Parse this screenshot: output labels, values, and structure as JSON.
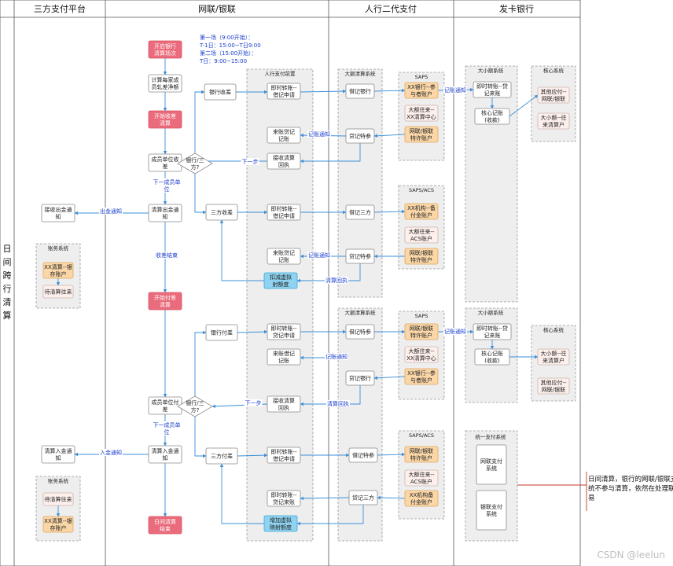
{
  "lanes": [
    "三方支付平台",
    "网联/银联",
    "人行二代支付",
    "发卡银行"
  ],
  "side_label": "日间跨行清算",
  "note": "日间清算，银行的网联/银联支付系统不参与清算，依然在处理联机交易",
  "watermark": "CSDN @leelun",
  "groups": {
    "renhang_front": "人行支付前置",
    "daer_1": "大额清算系统",
    "saps_1": "SAPS",
    "saps_acs_1": "SAPS/ACS",
    "daer_2": "大额清算系统",
    "saps_2": "SAPS",
    "saps_acs_2": "SAPS/ACS",
    "xiao_1": "大小额系统",
    "core_1": "核心系统",
    "xiao_2": "大小额系统",
    "core_2": "核心系统",
    "unified": "统一支付系统",
    "acct_1": "账务系统",
    "acct_2": "账务系统"
  },
  "session_info": {
    "l1": "第一场（9:00开始）：",
    "l2": "T-1日：15:00~T日9:00",
    "l3": "第二场（15:00开始）：",
    "l4": "T日：9:00~15:00"
  },
  "nodes": {
    "start_batch": [
      "开启银行",
      "清算场次"
    ],
    "calc_net": [
      "计算每家成",
      "员轧差净额"
    ],
    "start_recv": [
      "开始收差",
      "清算"
    ],
    "member_recv": [
      "成员单位收",
      "差"
    ],
    "diamond_1": [
      "银行/三",
      "方?"
    ],
    "bank_recv": [
      "银行收差"
    ],
    "clear_out_notice": [
      "清算出金通",
      "知"
    ],
    "third_recv": [
      "三方收差"
    ],
    "start_pay": [
      "开始付差",
      "清算"
    ],
    "bank_pay": [
      "银行付差"
    ],
    "member_pay": [
      "成员单位付",
      "差"
    ],
    "diamond_2": [
      "银行/三",
      "方?"
    ],
    "clear_in_notice": [
      "清算入金通",
      "知"
    ],
    "third_pay": [
      "三方付差"
    ],
    "day_end": [
      "日间清算",
      "结束"
    ],
    "recv_out_notice": [
      "接收出金通",
      "知"
    ],
    "recv_in_notice": [
      "清算入金通",
      "知"
    ],
    "acc_1a": [
      "XX清算--银",
      "存账户"
    ],
    "acc_1b": [
      "待清算往来"
    ],
    "acc_2a": [
      "待清算往来"
    ],
    "acc_2b": [
      "XX清算--银",
      "存账户"
    ],
    "f1": [
      "即时转账--",
      "借记申请"
    ],
    "f2": [
      "来账贷记",
      "记账"
    ],
    "f3": [
      "接收清算",
      "回执"
    ],
    "f4": [
      "即时转账--",
      "借记申请"
    ],
    "f5": [
      "来账贷记",
      "记账"
    ],
    "f6": [
      "扣减虚拟",
      "射额度"
    ],
    "f7": [
      "即时转账--",
      "贷记申请"
    ],
    "f8": [
      "来账借记",
      "记账"
    ],
    "f9": [
      "接收清算",
      "回执"
    ],
    "f10": [
      "即时转账--",
      "借记申请"
    ],
    "f11": [
      "即时转账--",
      "贷记来账"
    ],
    "f12": [
      "增加虚拟",
      "映射额度"
    ],
    "p1": [
      "借记银行"
    ],
    "p2": [
      "贷记特参"
    ],
    "p3": [
      "借记三方"
    ],
    "p4": [
      "贷记特参"
    ],
    "p5": [
      "借记特参"
    ],
    "p6": [
      "贷记银行"
    ],
    "p7": [
      "借记特参"
    ],
    "p8": [
      "贷记三方"
    ],
    "s1a": [
      "XX银行--参",
      "与者账户"
    ],
    "s1b": [
      "大额往来--",
      "XX清算中心"
    ],
    "s1c": [
      "网联/银联",
      "特许账户"
    ],
    "s2a": [
      "XX机构--备",
      "付金账户"
    ],
    "s2b": [
      "大额往来--",
      "ACS账户"
    ],
    "s2c": [
      "网联/银联",
      "特许账户"
    ],
    "s3a": [
      "网联/银联",
      "特许账户"
    ],
    "s3b": [
      "大额往来--",
      "XX清算中心"
    ],
    "s3c": [
      "XX银行--参",
      "与者账户"
    ],
    "s4a": [
      "网联/银联",
      "特许账户"
    ],
    "s4b": [
      "大额往来--",
      "ACS账户"
    ],
    "s4c": [
      "XX机构备",
      "付金账户"
    ],
    "b1": [
      "即时转账--贷",
      "记来账"
    ],
    "b2": [
      "核心记账",
      "(收款)"
    ],
    "c1a": [
      "其他应付--",
      "网联/银联"
    ],
    "c1b": [
      "大小额--往",
      "来清算户"
    ],
    "b3": [
      "即时转账--贷",
      "记来账"
    ],
    "b4": [
      "核心记账",
      "(收款)"
    ],
    "c2a": [
      "大小额--往",
      "来清算户"
    ],
    "c2b": [
      "其他应付--",
      "网联/银联"
    ],
    "u1": [
      "网联支付",
      "系统"
    ],
    "u2": [
      "银联支付",
      "系统"
    ]
  },
  "edge_labels": {
    "e_next_1": "下一步",
    "e_next_member_1": [
      "下一成员单",
      "位"
    ],
    "e_out_notice": "出金通知",
    "e_recv_end": "收差结束",
    "e_credit_notice_1": "记账通知",
    "e_credit_notice_2": "记账通知",
    "e_clear_receipt_1": "清算回执",
    "e_credit_notice_3": "记账通知",
    "e_credit_notice_4": "记账通知",
    "e_next_2": "下一步",
    "e_next_member_2": [
      "下一成员单",
      "位"
    ],
    "e_clear_receipt_2": "清算回执",
    "e_in_notice": "入金通知",
    "e_credit_notice_5": "记账通知"
  }
}
